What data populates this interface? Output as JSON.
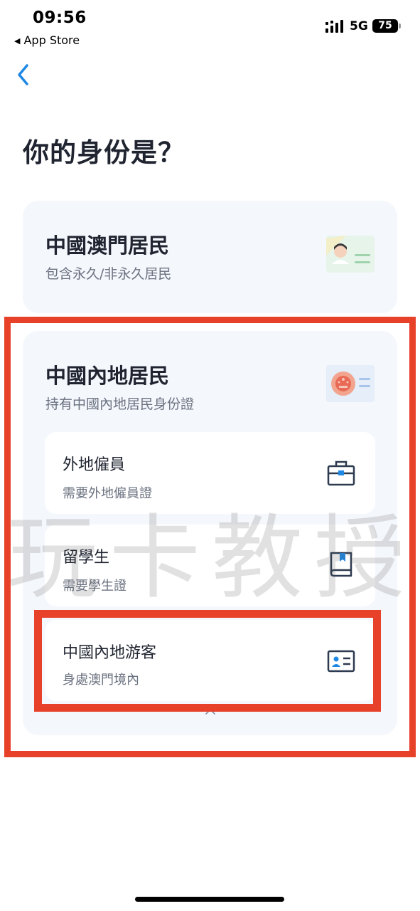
{
  "status_bar": {
    "time": "09:56",
    "back_app": "App Store",
    "network": "5G",
    "battery": "75"
  },
  "page": {
    "title": "你的身份是？"
  },
  "options": {
    "macau": {
      "title": "中國澳門居民",
      "subtitle": "包含永久/非永久居民",
      "icon": "id-card-person-illustration"
    },
    "mainland": {
      "title": "中國內地居民",
      "subtitle": "持有中國內地居民身份證",
      "icon": "id-card-emblem-illustration",
      "sub_options": [
        {
          "title": "外地僱員",
          "subtitle": "需要外地僱員證",
          "icon": "briefcase-icon"
        },
        {
          "title": "留學生",
          "subtitle": "需要學生證",
          "icon": "book-icon"
        },
        {
          "title": "中國內地游客",
          "subtitle": "身處澳門境內",
          "icon": "id-card-icon"
        }
      ]
    }
  },
  "watermark": "玩卡教授",
  "colors": {
    "accent": "#1e88e5",
    "highlight": "#e8412a",
    "card_bg": "#f4f7fc",
    "icon_dark": "#2d3a4f"
  }
}
